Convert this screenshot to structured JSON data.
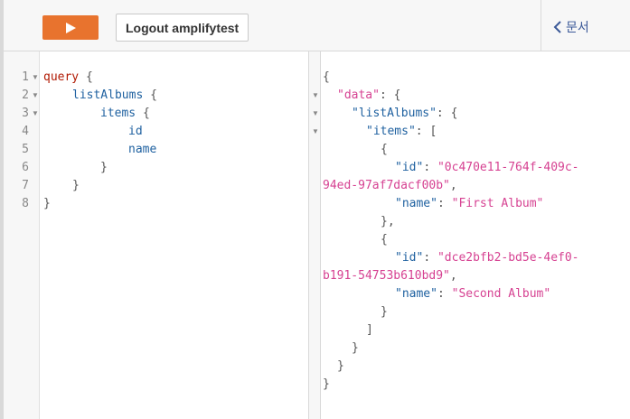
{
  "toolbar": {
    "run_icon": "play-icon",
    "logout_label": "Logout amplifytest",
    "docs_label": "문서",
    "docs_icon": "chevron-left-icon",
    "accent_color": "#e8732e"
  },
  "query_editor": {
    "line_numbers": [
      "1",
      "2",
      "3",
      "4",
      "5",
      "6",
      "7",
      "8"
    ],
    "lines": {
      "l1_kw": "query",
      "l1_brace": " {",
      "l2_field": "listAlbums",
      "l2_brace": " {",
      "l3_field": "items",
      "l3_brace": " {",
      "l4_field": "id",
      "l5_field": "name",
      "l6": "}",
      "l7": "}",
      "l8": "}"
    }
  },
  "result_viewer": {
    "open_brace": "{",
    "data_key": "\"data\"",
    "list_key": "\"listAlbums\"",
    "items_key": "\"items\"",
    "colon_brace": ": {",
    "colon_bracket": ": [",
    "items": [
      {
        "id_key": "\"id\"",
        "id_part1": "\"0c470e11-764f-409c-",
        "id_part2": "94ed-97af7dacf00b\"",
        "name_key": "\"name\"",
        "name_value": "\"First Album\""
      },
      {
        "id_key": "\"id\"",
        "id_part1": "\"dce2bfb2-bd5e-4ef0-",
        "id_part2": "b191-54753b610bd9\"",
        "name_key": "\"name\"",
        "name_value": "\"Second Album\""
      }
    ]
  }
}
